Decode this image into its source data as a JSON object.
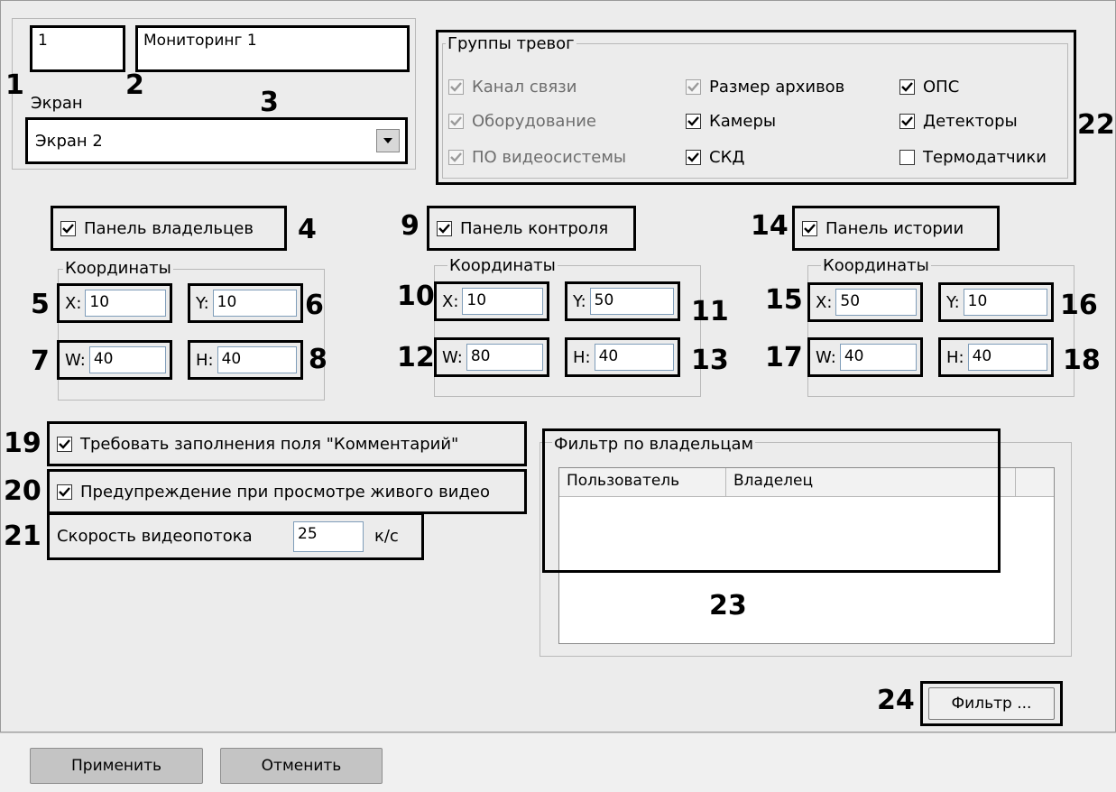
{
  "screen": {
    "number_value": "1",
    "name_value": "Мониторинг 1",
    "screen_label": "Экран",
    "screen_select_value": "Экран 2"
  },
  "alarm_groups": {
    "title": "Группы тревог",
    "items": [
      {
        "label": "Канал связи",
        "checked": true,
        "disabled": true
      },
      {
        "label": "Оборудование",
        "checked": true,
        "disabled": true
      },
      {
        "label": "ПО видеосистемы",
        "checked": true,
        "disabled": true
      },
      {
        "label": "Размер архивов",
        "checked": true,
        "disabled": true
      },
      {
        "label": "Камеры",
        "checked": true,
        "disabled": false
      },
      {
        "label": "СКД",
        "checked": true,
        "disabled": false
      },
      {
        "label": "ОПС",
        "checked": true,
        "disabled": false
      },
      {
        "label": "Детекторы",
        "checked": true,
        "disabled": false
      },
      {
        "label": "Термодатчики",
        "checked": false,
        "disabled": false
      }
    ]
  },
  "panels": [
    {
      "label": "Панель владельцев",
      "checked": true,
      "coords_title": "Координаты",
      "x_label": "X:",
      "x": "10",
      "y_label": "Y:",
      "y": "10",
      "w_label": "W:",
      "w": "40",
      "h_label": "H:",
      "h": "40"
    },
    {
      "label": "Панель контроля",
      "checked": true,
      "coords_title": "Координаты",
      "x_label": "X:",
      "x": "10",
      "y_label": "Y:",
      "y": "50",
      "w_label": "W:",
      "w": "80",
      "h_label": "H:",
      "h": "40"
    },
    {
      "label": "Панель истории",
      "checked": true,
      "coords_title": "Координаты",
      "x_label": "X:",
      "x": "50",
      "y_label": "Y:",
      "y": "10",
      "w_label": "W:",
      "w": "40",
      "h_label": "H:",
      "h": "40"
    }
  ],
  "options": {
    "require_comment_label": "Требовать заполнения поля \"Комментарий\"",
    "require_comment_checked": true,
    "live_warning_label": "Предупреждение при просмотре живого видео",
    "live_warning_checked": true,
    "speed_label": "Скорость видеопотока",
    "speed_value": "25",
    "speed_unit": "к/с"
  },
  "owner_filter": {
    "title": "Фильтр по владельцам",
    "columns": [
      "Пользователь",
      "Владелец"
    ],
    "filter_button": "Фильтр ..."
  },
  "callouts": {
    "n1": "1",
    "n2": "2",
    "n3": "3",
    "n4": "4",
    "n5": "5",
    "n6": "6",
    "n7": "7",
    "n8": "8",
    "n9": "9",
    "n10": "10",
    "n11": "11",
    "n12": "12",
    "n13": "13",
    "n14": "14",
    "n15": "15",
    "n16": "16",
    "n17": "17",
    "n18": "18",
    "n19": "19",
    "n20": "20",
    "n21": "21",
    "n22": "22",
    "n23": "23",
    "n24": "24"
  },
  "footer": {
    "apply_label": "Применить",
    "cancel_label": "Отменить"
  }
}
